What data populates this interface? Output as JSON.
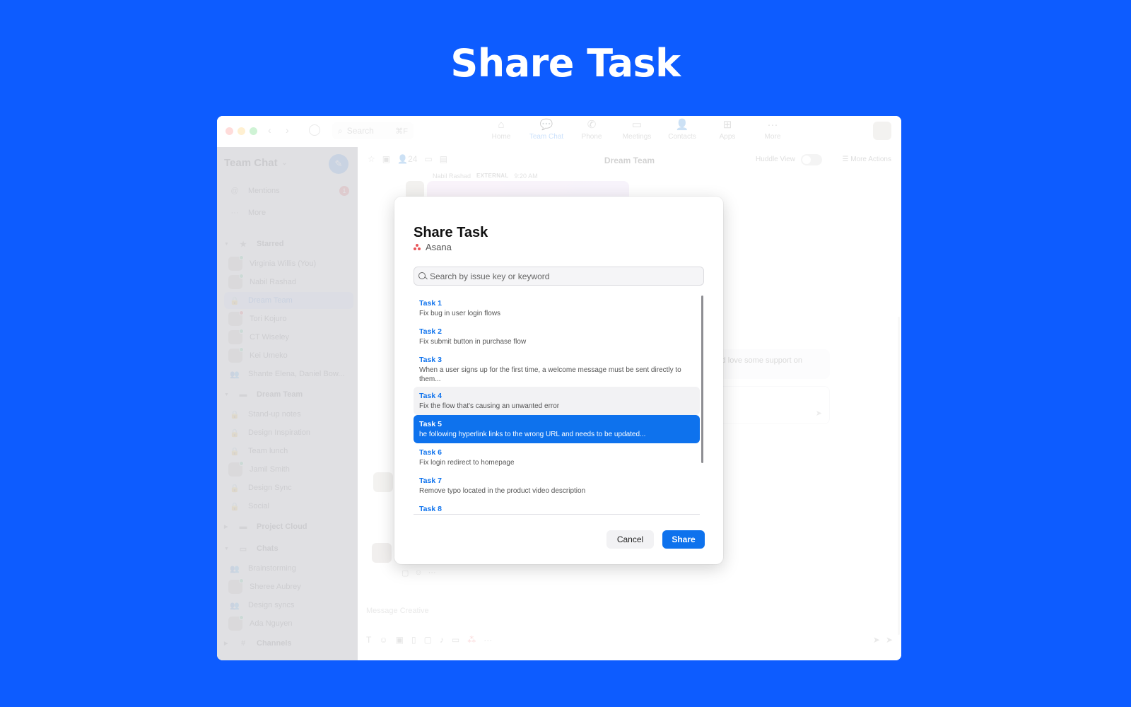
{
  "hero": {
    "title": "Share Task"
  },
  "titlebar": {
    "back": "‹",
    "forward": "›",
    "search_label": "Search",
    "search_shortcut": "⌘F",
    "nav": [
      {
        "label": "Home",
        "icon": "⌂"
      },
      {
        "label": "Team Chat",
        "icon": "💬"
      },
      {
        "label": "Phone",
        "icon": "✆"
      },
      {
        "label": "Meetings",
        "icon": "▭"
      },
      {
        "label": "Contacts",
        "icon": "👤"
      },
      {
        "label": "Apps",
        "icon": "⊞"
      },
      {
        "label": "More",
        "icon": "···"
      }
    ]
  },
  "sidebar": {
    "title": "Team Chat",
    "chevron": "⌄",
    "compose_icon": "✎",
    "mentions": {
      "label": "Mentions",
      "icon": "@",
      "badge": "1"
    },
    "more": {
      "label": "More",
      "icon": "···"
    },
    "starred": {
      "label": "Starred",
      "items": [
        {
          "label": "Virginia Willis (You)"
        },
        {
          "label": "Nabil Rashad"
        },
        {
          "label": "Dream Team"
        },
        {
          "label": "Tori Kojuro"
        },
        {
          "label": "CT Wiseley"
        },
        {
          "label": "Kei Umeko"
        },
        {
          "label": "Shante Elena, Daniel Bow..."
        }
      ]
    },
    "dream_team": {
      "label": "Dream Team",
      "items": [
        {
          "label": "Stand-up notes"
        },
        {
          "label": "Design Inspiration"
        },
        {
          "label": "Team lunch"
        },
        {
          "label": "Jamil Smith"
        },
        {
          "label": "Design Sync"
        },
        {
          "label": "Social"
        }
      ]
    },
    "project_cloud": {
      "label": "Project Cloud"
    },
    "chats": {
      "label": "Chats",
      "items": [
        {
          "label": "Brainstorming"
        },
        {
          "label": "Sheree Aubrey"
        },
        {
          "label": "Design syncs"
        },
        {
          "label": "Ada Nguyen"
        }
      ]
    },
    "channels": {
      "label": "Channels"
    }
  },
  "channel": {
    "title": "Dream Team",
    "member_count": "24",
    "huddle_label": "Huddle View",
    "huddle_on": false,
    "more_actions": "More Actions",
    "message_author": "Nabil Rashad",
    "message_tag": "EXTERNAL",
    "message_time": "9:20 AM",
    "bubble_text": "would love some support on",
    "composer_placeholder": "Message Creative"
  },
  "modal": {
    "title": "Share Task",
    "integration": "Asana",
    "search_placeholder": "Search by issue key or keyword",
    "search_value": "",
    "tasks": [
      {
        "key": "Task 1",
        "desc": "Fix bug in user login flows",
        "state": ""
      },
      {
        "key": "Task 2",
        "desc": "Fix submit button in purchase flow",
        "state": ""
      },
      {
        "key": "Task 3",
        "desc": "When a user signs up for the first time, a welcome message must be sent directly to them...",
        "state": ""
      },
      {
        "key": "Task 4",
        "desc": "Fix the flow that's causing an unwanted error",
        "state": "hover"
      },
      {
        "key": "Task 5",
        "desc": "he following hyperlink links to the wrong URL and needs to be updated...",
        "state": "selected"
      },
      {
        "key": "Task 6",
        "desc": "Fix login redirect to homepage",
        "state": ""
      },
      {
        "key": "Task 7",
        "desc": "Remove typo located in the product video description",
        "state": ""
      },
      {
        "key": "Task 8",
        "desc": "",
        "state": ""
      }
    ],
    "cancel_label": "Cancel",
    "share_label": "Share"
  }
}
